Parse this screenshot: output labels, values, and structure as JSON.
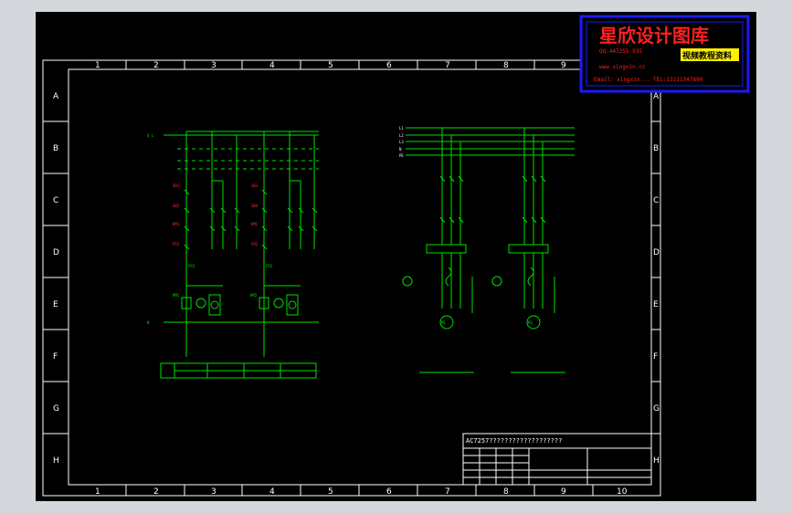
{
  "drawing": {
    "col_numbers": [
      "1",
      "2",
      "3",
      "4",
      "5",
      "6",
      "7",
      "8",
      "9",
      "10"
    ],
    "row_letters": [
      "A",
      "B",
      "C",
      "D",
      "E",
      "F",
      "G",
      "H"
    ]
  },
  "watermark": {
    "title": "星欣设计图库",
    "qq": "QQ:447255 935",
    "yellow_tag": "视频教程资料",
    "website": "www.xingxin.cc",
    "email_line": "Email: xingxin... TEL:13111347890"
  },
  "title_block": {
    "title": "AC7257???????????????????"
  },
  "labels": {
    "left_top_rail": "Q   L",
    "left_bottom_rail": "N",
    "right_motor1": "M1",
    "right_motor2": "M2",
    "sb1": "SB1",
    "sb2": "SB2",
    "km1": "KM1",
    "km2": "KM2",
    "fr1": "FR1",
    "fr2": "FR2"
  },
  "colors": {
    "background": "#000000",
    "wiring": "#00e000",
    "terminals": "#ff3030",
    "frame": "#ffffff",
    "logo_border": "#1a1aff"
  }
}
